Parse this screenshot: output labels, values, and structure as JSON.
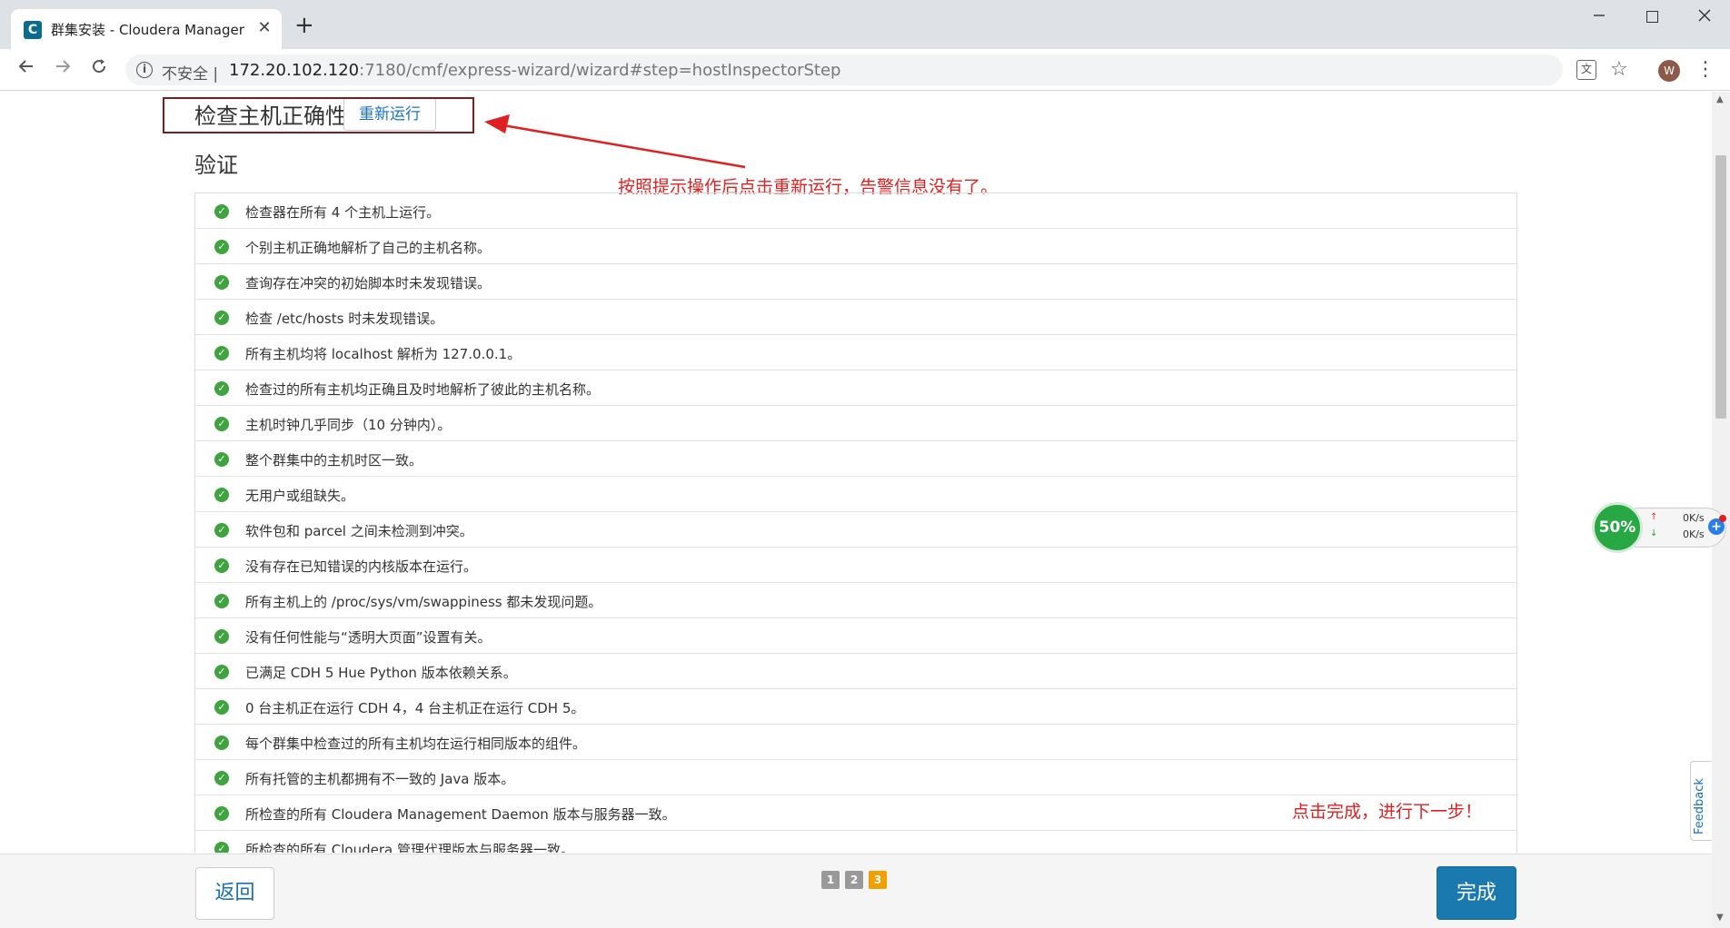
{
  "browser": {
    "tab_title": "群集安装 - Cloudera Manager",
    "tab_favicon_letter": "C",
    "tab_close": "✕",
    "new_tab": "+",
    "insecure_label": "不安全",
    "url_host": "172.20.102.120",
    "url_rest": ":7180/cmf/express-wizard/wizard#step=hostInspectorStep",
    "avatar_letter": "W"
  },
  "page": {
    "section_title": "检查主机正确性",
    "rerun_label": "重新运行",
    "verify_title": "验证",
    "annotation_top": "按照提示操作后点击重新运行，告警信息没有了。",
    "annotation_bottom": "点击完成，进行下一步！",
    "checks": [
      "检查器在所有 4 个主机上运行。",
      "个别主机正确地解析了自己的主机名称。",
      "查询存在冲突的初始脚本时未发现错误。",
      "检查 /etc/hosts 时未发现错误。",
      "所有主机均将 localhost 解析为 127.0.0.1。",
      "检查过的所有主机均正确且及时地解析了彼此的主机名称。",
      "主机时钟几乎同步（10 分钟内）。",
      "整个群集中的主机时区一致。",
      "无用户或组缺失。",
      "软件包和 parcel 之间未检测到冲突。",
      "没有存在已知错误的内核版本在运行。",
      "所有主机上的 /proc/sys/vm/swappiness 都未发现问题。",
      "没有任何性能与“透明大页面”设置有关。",
      "已满足 CDH 5 Hue Python 版本依赖关系。",
      "0 台主机正在运行 CDH 4，4 台主机正在运行 CDH 5。",
      "每个群集中检查过的所有主机均在运行相同版本的组件。",
      "所有托管的主机都拥有不一致的 Java 版本。",
      "所检查的所有 Cloudera Management Daemon 版本与服务器一致。",
      "所检查的所有 Cloudera 管理代理版本与服务器一致。"
    ]
  },
  "footer": {
    "back_label": "返回",
    "finish_label": "完成",
    "steps": [
      "1",
      "2",
      "3"
    ],
    "current_step": 3
  },
  "feedback_label": "Feedback",
  "net_widget": {
    "percent": "50%",
    "up_speed": "0K/s",
    "down_speed": "0K/s"
  },
  "colors": {
    "accent": "#1a7ab0",
    "success": "#3fa33f",
    "annotation": "#e02020",
    "highlight_box": "#7a1e1e",
    "step_active": "#f0a000"
  }
}
